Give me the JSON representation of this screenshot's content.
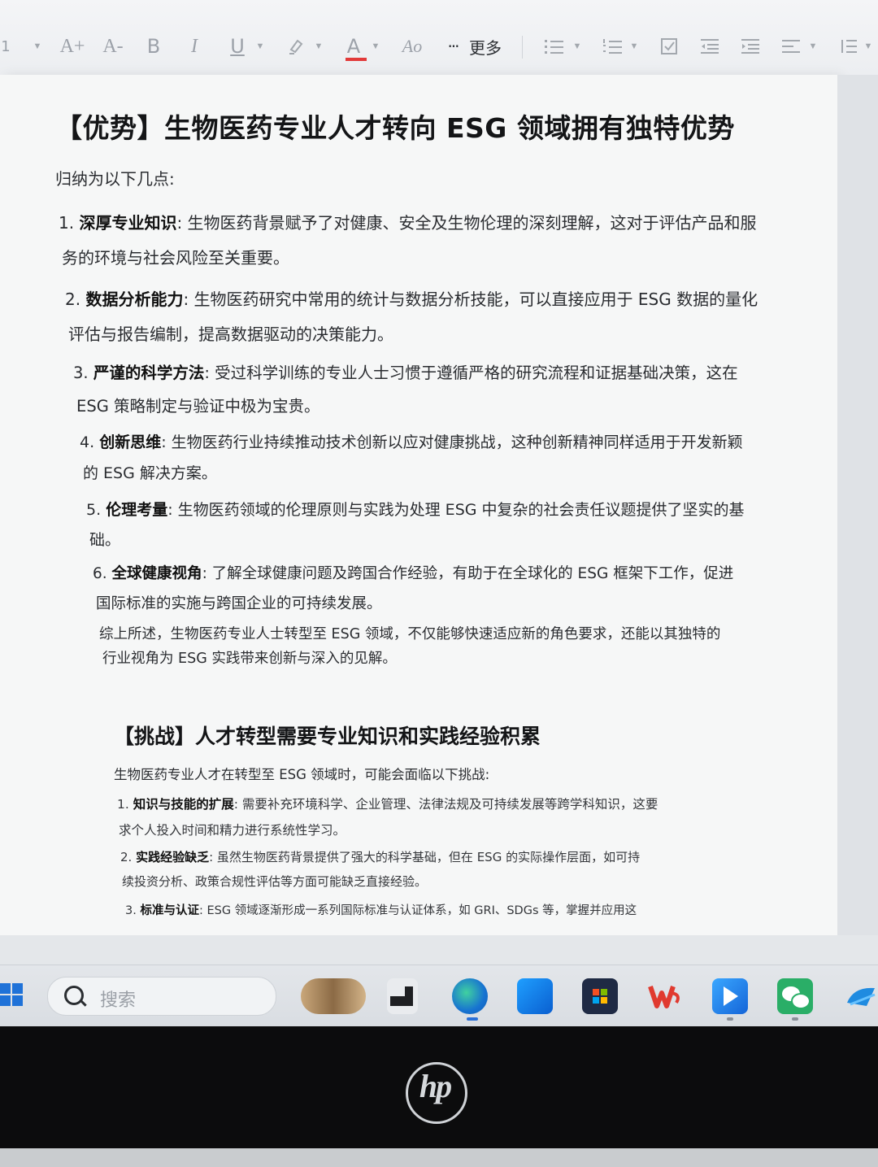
{
  "toolbar": {
    "font_size_value": "1",
    "increase_font": "A+",
    "decrease_font": "A-",
    "bold": "B",
    "italic": "I",
    "underline": "U",
    "font_color": "A",
    "clear_format": "Ao",
    "more_dots": "···",
    "more_label": "更多"
  },
  "document": {
    "title": "【优势】生物医药专业人才转向 ESG 领域拥有独特优势",
    "intro": "归纳为以下几点:",
    "items": [
      {
        "num": "1.",
        "term": "深厚专业知识",
        "line1": ": 生物医药背景赋予了对健康、安全及生物伦理的深刻理解，这对于评估产品和服",
        "line2": "务的环境与社会风险至关重要。"
      },
      {
        "num": "2.",
        "term": "数据分析能力",
        "line1": ": 生物医药研究中常用的统计与数据分析技能，可以直接应用于 ESG 数据的量化",
        "line2": "评估与报告编制，提高数据驱动的决策能力。"
      },
      {
        "num": "3.",
        "term": "严谨的科学方法",
        "line1": ": 受过科学训练的专业人士习惯于遵循严格的研究流程和证据基础决策，这在",
        "line2": "ESG 策略制定与验证中极为宝贵。"
      },
      {
        "num": "4.",
        "term": "创新思维",
        "line1": ": 生物医药行业持续推动技术创新以应对健康挑战，这种创新精神同样适用于开发新颖",
        "line2": "的 ESG 解决方案。"
      },
      {
        "num": "5.",
        "term": "伦理考量",
        "line1": ": 生物医药领域的伦理原则与实践为处理 ESG 中复杂的社会责任议题提供了坚实的基",
        "line2": "础。"
      },
      {
        "num": "6.",
        "term": "全球健康视角",
        "line1": ": 了解全球健康问题及跨国合作经验，有助于在全球化的 ESG 框架下工作，促进",
        "line2": "国际标准的实施与跨国企业的可持续发展。"
      }
    ],
    "summary_line1": "综上所述，生物医药专业人士转型至 ESG 领域，不仅能够快速适应新的角色要求，还能以其独特的",
    "summary_line2": "行业视角为 ESG 实践带来创新与深入的见解。",
    "section2_title": "【挑战】人才转型需要专业知识和实践经验积累",
    "section2_intro": "生物医药专业人才在转型至 ESG 领域时，可能会面临以下挑战:",
    "challenges": [
      {
        "num": "1.",
        "term": "知识与技能的扩展",
        "line1": ": 需要补充环境科学、企业管理、法律法规及可持续发展等跨学科知识，这要",
        "line2": "求个人投入时间和精力进行系统性学习。"
      },
      {
        "num": "2.",
        "term": "实践经验缺乏",
        "line1": ": 虽然生物医药背景提供了强大的科学基础，但在 ESG 的实际操作层面，如可持",
        "line2": "续投资分析、政策合规性评估等方面可能缺乏直接经验。"
      },
      {
        "num": "3.",
        "term": "标准与认证",
        "line1": ": ESG 领域逐渐形成一系列国际标准与认证体系，如 GRI、SDGs 等，掌握并应用这"
      }
    ]
  },
  "taskbar": {
    "search_placeholder": "搜索"
  },
  "bezel": {
    "brand": "hp"
  },
  "colors": {
    "font_color_underline": "#e23a3a",
    "start_blue": "#1f72d8",
    "wps_red": "#e03a2f",
    "wechat_green": "#2aae67"
  }
}
